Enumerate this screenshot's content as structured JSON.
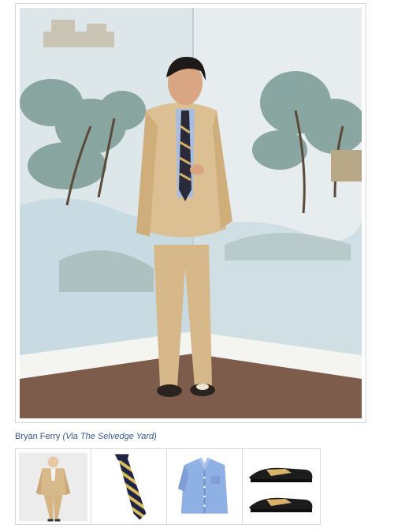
{
  "caption": {
    "name": "Bryan Ferry",
    "via": "(Via The Selvedge Yard)"
  },
  "thumbnails": [
    {
      "item": "suit-icon"
    },
    {
      "item": "tie-icon"
    },
    {
      "item": "shirt-icon"
    },
    {
      "item": "shoes-icon"
    }
  ],
  "colors": {
    "link": "#3a5a8c",
    "suit": "#d8b98a",
    "tie": "#222444",
    "shirt": "#7f9fd6",
    "shoe_tan": "#d9b36b"
  }
}
